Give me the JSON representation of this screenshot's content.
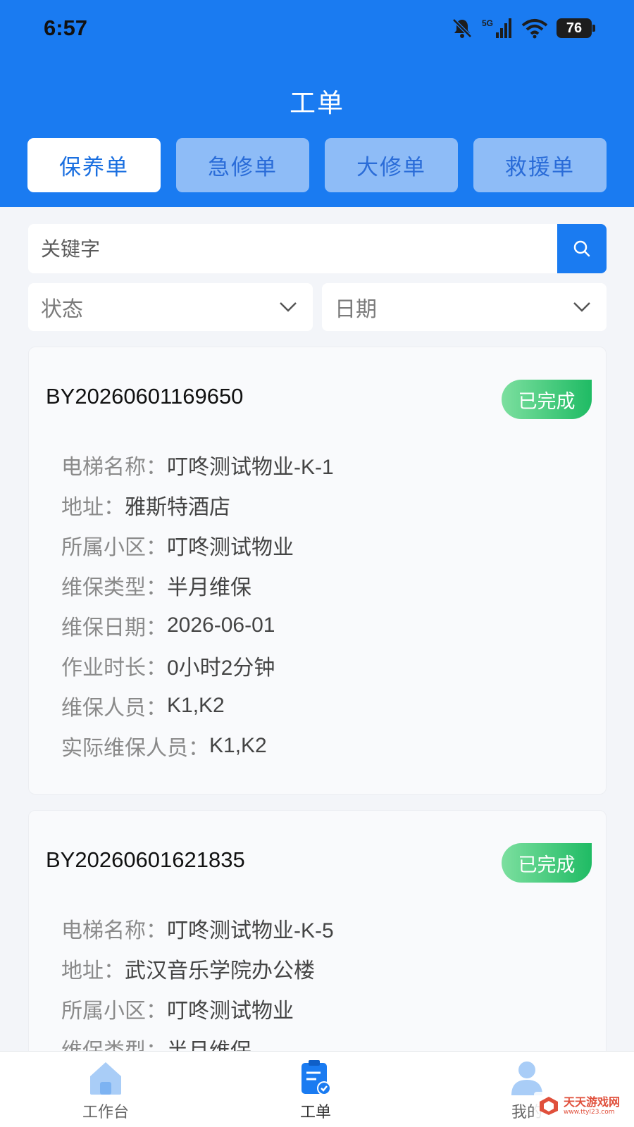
{
  "status_bar": {
    "time": "6:57",
    "battery": "76",
    "network": "5G"
  },
  "header": {
    "title": "工单"
  },
  "tabs": [
    {
      "label": "保养单",
      "active": true
    },
    {
      "label": "急修单",
      "active": false
    },
    {
      "label": "大修单",
      "active": false
    },
    {
      "label": "救援单",
      "active": false
    }
  ],
  "search": {
    "placeholder": "关键字"
  },
  "filters": {
    "status": "状态",
    "date": "日期"
  },
  "orders": [
    {
      "no": "BY20260601169650",
      "status": "已完成",
      "fields": [
        {
          "label": "电梯名称：",
          "value": "叮咚测试物业-K-1"
        },
        {
          "label": "地址：",
          "value": "雅斯特酒店"
        },
        {
          "label": "所属小区：",
          "value": "叮咚测试物业"
        },
        {
          "label": "维保类型：",
          "value": "半月维保"
        },
        {
          "label": "维保日期：",
          "value": "2026-06-01"
        },
        {
          "label": "作业时长：",
          "value": "0小时2分钟"
        },
        {
          "label": "维保人员：",
          "value": "K1,K2"
        },
        {
          "label": "实际维保人员：",
          "value": "K1,K2"
        }
      ]
    },
    {
      "no": "BY20260601621835",
      "status": "已完成",
      "fields": [
        {
          "label": "电梯名称：",
          "value": "叮咚测试物业-K-5"
        },
        {
          "label": "地址：",
          "value": "武汉音乐学院办公楼"
        },
        {
          "label": "所属小区：",
          "value": "叮咚测试物业"
        },
        {
          "label": "维保类型：",
          "value": "半月维保"
        }
      ]
    }
  ],
  "nav": [
    {
      "label": "工作台",
      "icon": "home-icon"
    },
    {
      "label": "工单",
      "icon": "clipboard-check-icon",
      "active": true
    },
    {
      "label": "我的",
      "icon": "user-icon"
    }
  ],
  "watermark": {
    "main": "天天游戏网",
    "sub": "www.ttyl23.com"
  },
  "colors": {
    "primary": "#1a7bf1",
    "badge": "#1fbb64"
  }
}
